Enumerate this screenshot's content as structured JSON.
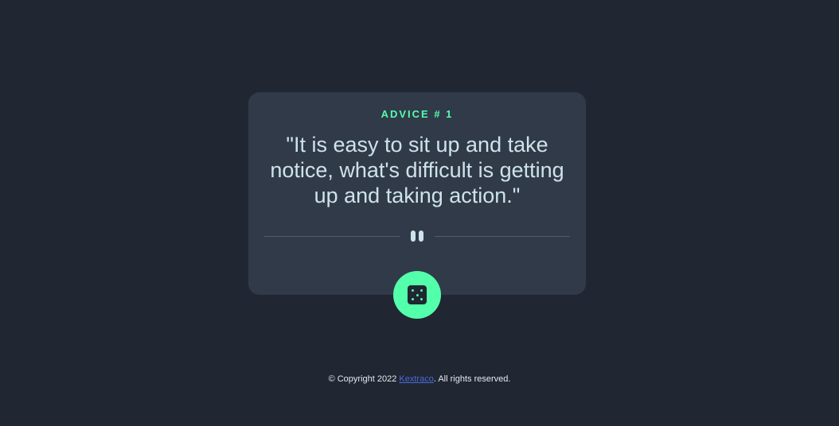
{
  "advice": {
    "label": "ADVICE # 1",
    "quote": "\"It is easy to sit up and take notice, what's difficult is getting up and taking action.\""
  },
  "controls": {
    "dice_icon": "dice-icon",
    "divider_icon": "pause-icon"
  },
  "footer": {
    "prefix": "© Copyright 2022 ",
    "link_text": "Kextraco",
    "suffix": ". All rights reserved."
  },
  "colors": {
    "background": "#202632",
    "card": "#313a49",
    "accent": "#53ffaa",
    "quote_text": "#cee3e9",
    "divider": "#4e5d73",
    "link": "#4b6bd8"
  }
}
